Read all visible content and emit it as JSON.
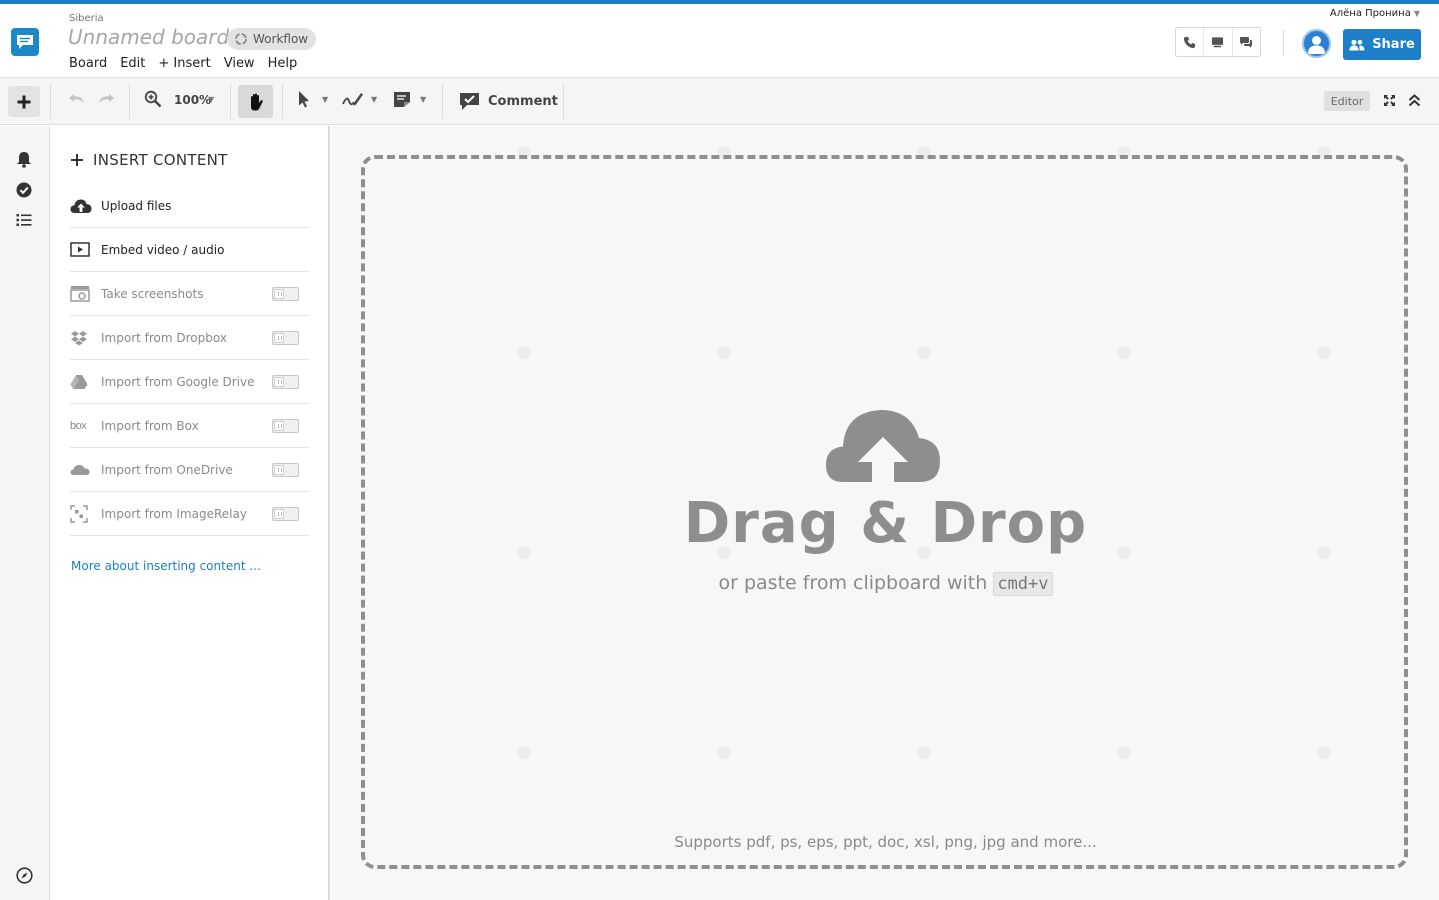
{
  "header": {
    "board_subtitle": "Siberia",
    "board_title": "Unnamed board",
    "workflow_label": "Workflow",
    "menu": [
      {
        "label": "Board"
      },
      {
        "label": "Edit"
      },
      {
        "label": "+ Insert"
      },
      {
        "label": "View"
      },
      {
        "label": "Help"
      }
    ],
    "user_name": "Алёна Пронина",
    "share_label": "Share"
  },
  "toolbar": {
    "zoom_level": "100%",
    "comment_label": "Comment",
    "mode_badge": "Editor"
  },
  "insert_panel": {
    "title": "INSERT CONTENT",
    "items": [
      {
        "label": "Upload files",
        "icon": "cloud-upload-icon",
        "enabled": true
      },
      {
        "label": "Embed video / audio",
        "icon": "video-icon",
        "enabled": true
      },
      {
        "label": "Take screenshots",
        "icon": "camera-icon",
        "enabled": false
      },
      {
        "label": "Import from Dropbox",
        "icon": "dropbox-icon",
        "enabled": false
      },
      {
        "label": "Import from Google Drive",
        "icon": "google-drive-icon",
        "enabled": false
      },
      {
        "label": "Import from Box",
        "icon": "box-icon",
        "enabled": false,
        "icon_text": "box"
      },
      {
        "label": "Import from OneDrive",
        "icon": "onedrive-icon",
        "enabled": false
      },
      {
        "label": "Import from ImageRelay",
        "icon": "imagerelay-icon",
        "enabled": false
      }
    ],
    "more_link": "More about inserting content ..."
  },
  "canvas": {
    "drop_title": "Drag & Drop",
    "drop_sub_prefix": "or paste from clipboard with",
    "drop_shortcut": "cmd+v",
    "supports_text": "Supports pdf, ps, eps, ppt, doc, xsl, png, jpg and more..."
  },
  "colors": {
    "accent": "#1c7fc8",
    "drop_text": "#8e8e8e"
  }
}
